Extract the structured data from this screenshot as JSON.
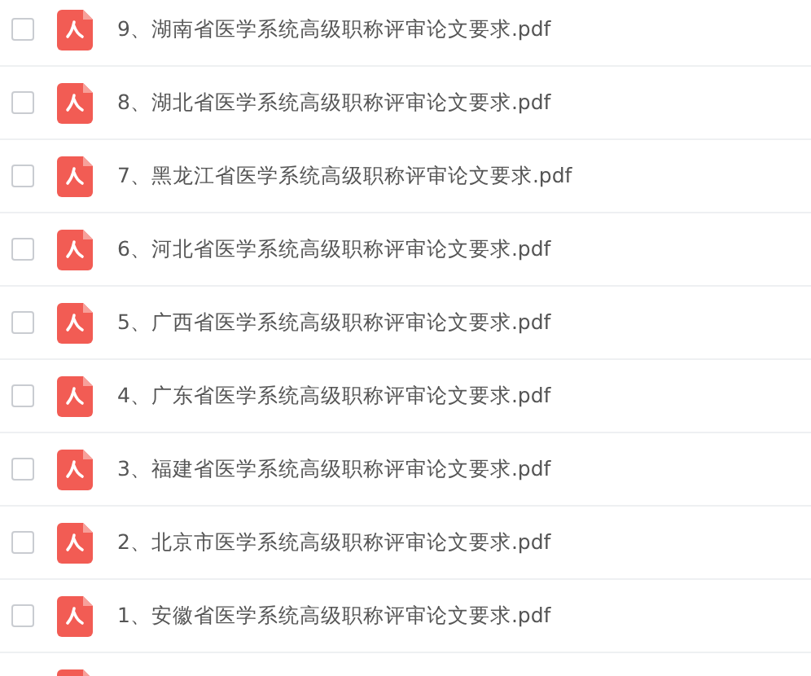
{
  "files": [
    {
      "kind": "pdf",
      "checked": false,
      "name": "9、湖南省医学系统高级职称评审论文要求.pdf"
    },
    {
      "kind": "pdf",
      "checked": false,
      "name": "8、湖北省医学系统高级职称评审论文要求.pdf"
    },
    {
      "kind": "pdf",
      "checked": false,
      "name": "7、黑龙江省医学系统高级职称评审论文要求.pdf"
    },
    {
      "kind": "pdf",
      "checked": false,
      "name": "6、河北省医学系统高级职称评审论文要求.pdf"
    },
    {
      "kind": "pdf",
      "checked": false,
      "name": "5、广西省医学系统高级职称评审论文要求.pdf"
    },
    {
      "kind": "pdf",
      "checked": false,
      "name": "4、广东省医学系统高级职称评审论文要求.pdf"
    },
    {
      "kind": "pdf",
      "checked": false,
      "name": "3、福建省医学系统高级职称评审论文要求.pdf"
    },
    {
      "kind": "pdf",
      "checked": false,
      "name": "2、北京市医学系统高级职称评审论文要求.pdf"
    },
    {
      "kind": "pdf",
      "checked": false,
      "name": "1、安徽省医学系统高级职称评审论文要求.pdf"
    },
    {
      "kind": "pdf"
    }
  ]
}
